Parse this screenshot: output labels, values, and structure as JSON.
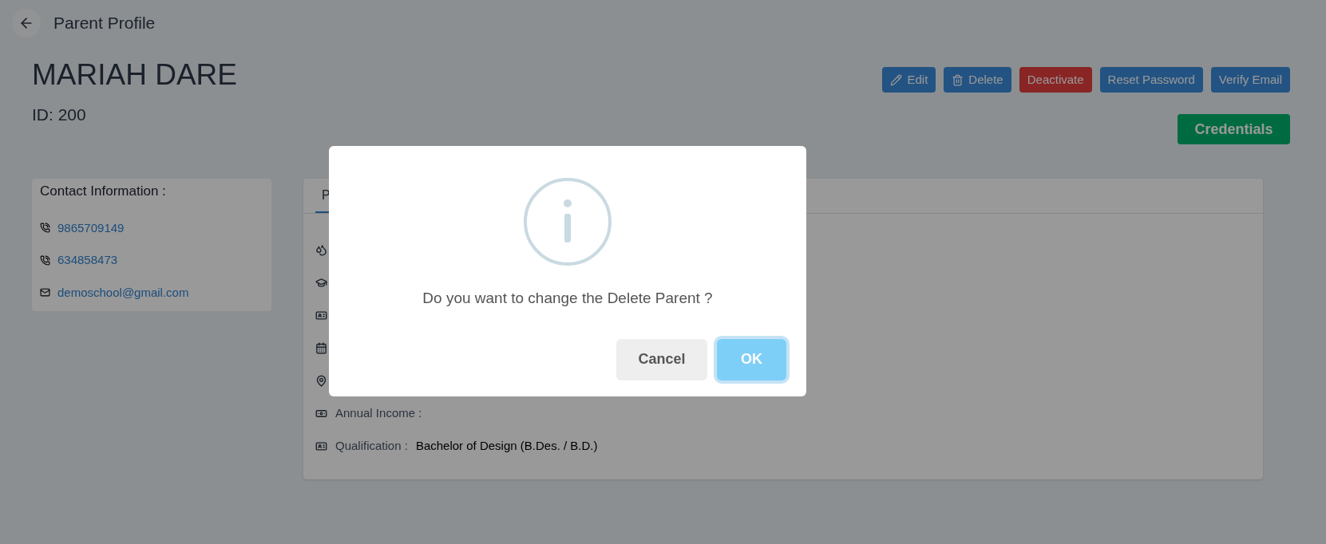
{
  "header": {
    "title": "Parent Profile"
  },
  "profile": {
    "name": "MARIAH DARE",
    "id": "ID: 200"
  },
  "actions": [
    {
      "label": "Edit",
      "kind": "edit"
    },
    {
      "label": "Delete",
      "kind": "delete"
    },
    {
      "label": "Deactivate",
      "kind": "danger"
    },
    {
      "label": "Reset Password",
      "kind": "plain"
    },
    {
      "label": "Verify Email",
      "kind": "plain"
    }
  ],
  "credentials_button": "Credentials",
  "contact": {
    "title": "Contact Information :",
    "items": [
      {
        "kind": "phone",
        "value": "9865709149"
      },
      {
        "kind": "phone",
        "value": "634858473"
      },
      {
        "kind": "email",
        "value": "demoschool@gmail.com"
      }
    ]
  },
  "details": {
    "tabs": [
      {
        "label": "P",
        "selected": true
      }
    ],
    "rows": [
      {
        "kind": "blood"
      },
      {
        "kind": "occupation"
      },
      {
        "kind": "card"
      },
      {
        "kind": "date"
      },
      {
        "kind": "location"
      },
      {
        "kind": "income",
        "label": "Annual Income :"
      },
      {
        "kind": "card",
        "label": "Qualification :",
        "value": "Bachelor of Design (B.Des. / B.D.)"
      }
    ]
  },
  "dialog": {
    "message": "Do you want to change the Delete Parent ?",
    "buttons": [
      {
        "label": "Cancel",
        "kind": "cancel"
      },
      {
        "label": "OK",
        "kind": "confirm"
      }
    ]
  }
}
